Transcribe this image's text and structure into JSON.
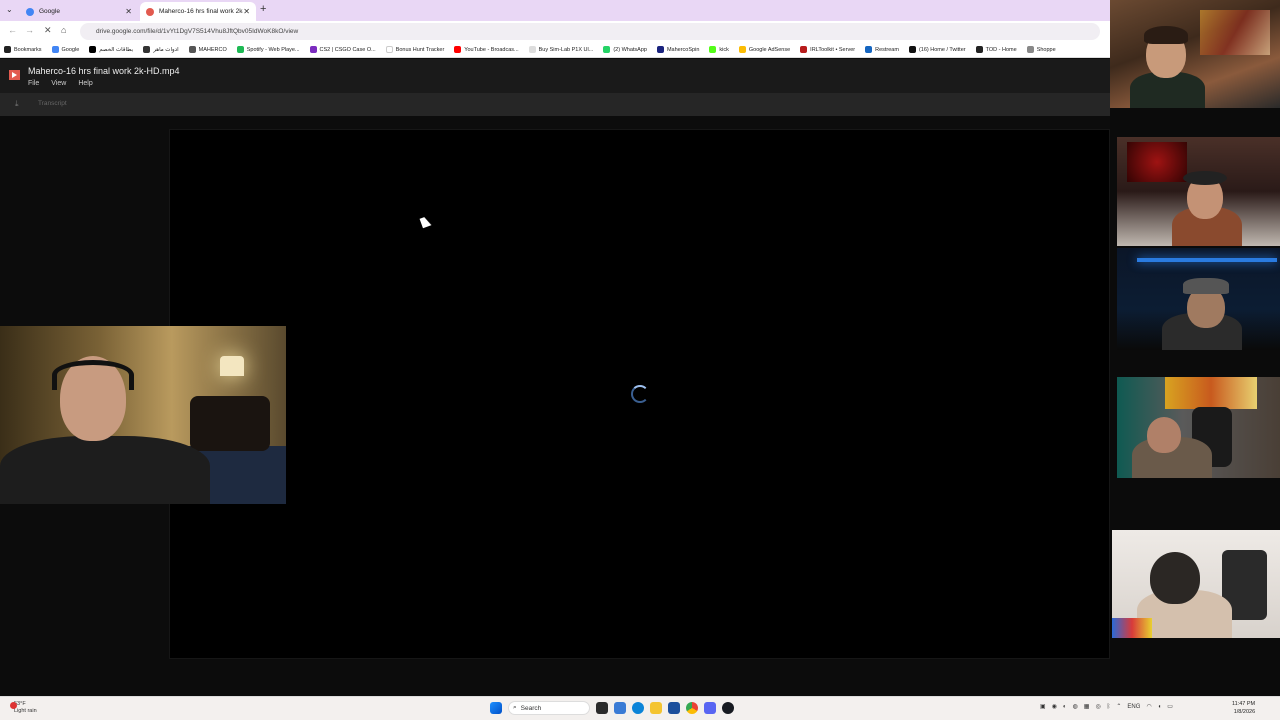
{
  "browser": {
    "tabs": [
      {
        "title": "Google",
        "favicon_color": "#4285f4"
      },
      {
        "title": "Maherco-16 hrs final work 2k-HD.mp4",
        "favicon_color": "#e25a4f"
      }
    ],
    "url": "drive.google.com/file/d/1vYt1DgV7S514Vhu8JftQbv05IdWoK8kO/view",
    "bookmarks": [
      {
        "label": "Bookmarks",
        "color": "#222"
      },
      {
        "label": "Google",
        "color": "#4285f4"
      },
      {
        "label": "بطاقات الخصم",
        "color": "#000"
      },
      {
        "label": "ادوات ماهر",
        "color": "#333"
      },
      {
        "label": "MAHERCO",
        "color": "#555"
      },
      {
        "label": "Spotify - Web Playe...",
        "color": "#1db954"
      },
      {
        "label": "CS2 | CSGO Case O...",
        "color": "#7b2cbf"
      },
      {
        "label": "Bonus Hunt Tracker",
        "color": "#ffffff"
      },
      {
        "label": "YouTube - Broadcas...",
        "color": "#ff0000"
      },
      {
        "label": "Buy Sim-Lab P1X Ul...",
        "color": "#ddd"
      },
      {
        "label": "(2) WhatsApp",
        "color": "#25d366"
      },
      {
        "label": "MahercoSpin",
        "color": "#1a237e"
      },
      {
        "label": "kick",
        "color": "#53fc18"
      },
      {
        "label": "Google AdSense",
        "color": "#fbbc04"
      },
      {
        "label": "IRLToolkit • Server",
        "color": "#b71c1c"
      },
      {
        "label": "Restream",
        "color": "#1565c0"
      },
      {
        "label": "(16) Home / Twitter",
        "color": "#111"
      },
      {
        "label": "TOD - Home",
        "color": "#222"
      },
      {
        "label": "Shoppe",
        "color": "#888"
      }
    ]
  },
  "drive": {
    "file_title": "Maherco-16 hrs final work 2k-HD.mp4",
    "menu": [
      "File",
      "View",
      "Help"
    ],
    "transcript_label": "Transcript"
  },
  "taskbar": {
    "weather_temp": "53°F",
    "weather_desc": "Light rain",
    "search_placeholder": "Search",
    "lang": "ENG",
    "time": "11:47 PM",
    "date": "1/8/2026"
  }
}
